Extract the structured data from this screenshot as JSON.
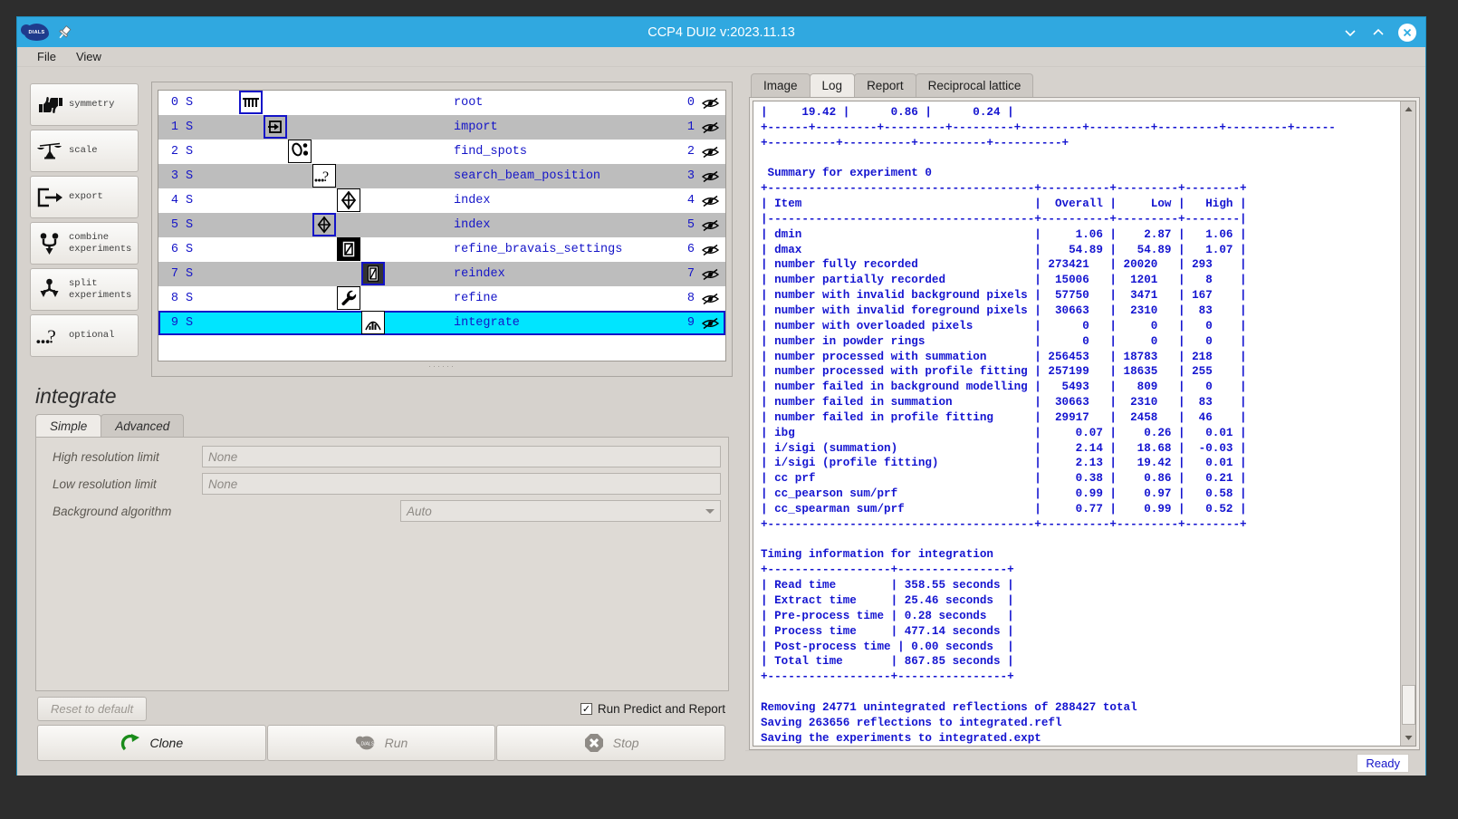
{
  "titlebar": {
    "title": "CCP4 DUI2 v:2023.11.13",
    "logo_text": "DIALS",
    "minimize_icon": "chevron-down-icon",
    "maximize_icon": "chevron-up-icon",
    "close_icon": "close-icon"
  },
  "menubar": {
    "items": [
      "File",
      "View"
    ]
  },
  "sidebar": {
    "items": [
      {
        "label": "symmetry",
        "icon": "thumbs-updown-icon"
      },
      {
        "label": "scale",
        "icon": "balance-scale-icon"
      },
      {
        "label": "export",
        "icon": "export-arrow-icon"
      },
      {
        "label": "combine\nexperiments",
        "icon": "combine-icon"
      },
      {
        "label": "split\nexperiments",
        "icon": "split-icon"
      },
      {
        "label": "optional",
        "icon": "question-dots-icon"
      }
    ]
  },
  "tree": {
    "rows": [
      {
        "index": "0",
        "flag": "S",
        "name": "root",
        "num": "0",
        "icon": "bars-icon",
        "selected": false
      },
      {
        "index": "1",
        "flag": "S",
        "name": "import",
        "num": "1",
        "icon": "import-icon",
        "selected": false
      },
      {
        "index": "2",
        "flag": "S",
        "name": "find_spots",
        "num": "2",
        "icon": "find-spots-icon",
        "selected": false
      },
      {
        "index": "3",
        "flag": "S",
        "name": "search_beam_position",
        "num": "3",
        "icon": "question-dots-icon",
        "selected": false
      },
      {
        "index": "4",
        "flag": "S",
        "name": "index",
        "num": "4",
        "icon": "index-diamond-icon",
        "selected": false
      },
      {
        "index": "5",
        "flag": "S",
        "name": "index",
        "num": "5",
        "icon": "index-diamond-icon",
        "selected": false
      },
      {
        "index": "6",
        "flag": "S",
        "name": "refine_bravais_settings",
        "num": "6",
        "icon": "bravais-icon",
        "selected": false
      },
      {
        "index": "7",
        "flag": "S",
        "name": "reindex",
        "num": "7",
        "icon": "reindex-icon",
        "selected": false
      },
      {
        "index": "8",
        "flag": "S",
        "name": "refine",
        "num": "8",
        "icon": "wrench-icon",
        "selected": false
      },
      {
        "index": "9",
        "flag": "S",
        "name": "integrate",
        "num": "9",
        "icon": "integrate-icon",
        "selected": true
      }
    ],
    "eye_icon": "eye-hidden-icon"
  },
  "task": {
    "title": "integrate",
    "tabs": [
      {
        "label": "Simple",
        "active": true
      },
      {
        "label": "Advanced",
        "active": false
      }
    ],
    "fields": [
      {
        "label": "High resolution limit",
        "value": "None",
        "type": "text"
      },
      {
        "label": "Low resolution limit",
        "value": "None",
        "type": "text"
      },
      {
        "label": "Background algorithm",
        "value": "Auto",
        "type": "select"
      }
    ],
    "reset_label": "Reset to default",
    "predict_label": "Run Predict and Report",
    "predict_checked": true,
    "check_glyph": "✓",
    "actions": [
      {
        "label": "Clone",
        "icon": "clone-arrow-icon",
        "enabled": true
      },
      {
        "label": "Run",
        "icon": "dials-run-icon",
        "enabled": false
      },
      {
        "label": "Stop",
        "icon": "stop-octagon-icon",
        "enabled": false
      }
    ]
  },
  "right_panel": {
    "tabs": [
      {
        "label": "Image",
        "active": false
      },
      {
        "label": "Log",
        "active": true
      },
      {
        "label": "Report",
        "active": false
      },
      {
        "label": "Reciprocal lattice",
        "active": false
      }
    ],
    "log_text": "|     19.42 |      0.86 |      0.24 |\n+------+---------+---------+---------+---------+---------+---------+---------+------\n+----------+----------+----------+----------+\n\n Summary for experiment 0\n+---------------------------------------+----------+---------+--------+\n| Item                                  |  Overall |     Low |   High |\n|---------------------------------------+----------+---------+--------|\n| dmin                                  |     1.06 |    2.87 |   1.06 |\n| dmax                                  |    54.89 |   54.89 |   1.07 |\n| number fully recorded                 | 273421   | 20020   | 293    |\n| number partially recorded             |  15006   |  1201   |   8    |\n| number with invalid background pixels |  57750   |  3471   | 167    |\n| number with invalid foreground pixels |  30663   |  2310   |  83    |\n| number with overloaded pixels         |      0   |     0   |   0    |\n| number in powder rings                |      0   |     0   |   0    |\n| number processed with summation       | 256453   | 18783   | 218    |\n| number processed with profile fitting | 257199   | 18635   | 255    |\n| number failed in background modelling |   5493   |   809   |   0    |\n| number failed in summation            |  30663   |  2310   |  83    |\n| number failed in profile fitting      |  29917   |  2458   |  46    |\n| ibg                                   |     0.07 |    0.26 |   0.01 |\n| i/sigi (summation)                    |     2.14 |   18.68 |  -0.03 |\n| i/sigi (profile fitting)              |     2.13 |   19.42 |   0.01 |\n| cc prf                                |     0.38 |    0.86 |   0.21 |\n| cc_pearson sum/prf                    |     0.99 |    0.97 |   0.58 |\n| cc_spearman sum/prf                   |     0.77 |    0.99 |   0.52 |\n+---------------------------------------+----------+---------+--------+\n\nTiming information for integration\n+------------------+----------------+\n| Read time        | 358.55 seconds |\n| Extract time     | 25.46 seconds  |\n| Pre-process time | 0.28 seconds   |\n| Process time     | 477.14 seconds |\n| Post-process time | 0.00 seconds  |\n| Total time       | 867.85 seconds |\n+------------------+----------------+\n\nRemoving 24771 unintegrated reflections of 288427 total\nSaving 263656 reflections to integrated.refl\nSaving the experiments to integrated.expt",
    "scroll_up_icon": "scroll-up-arrow-icon",
    "scroll_down_icon": "scroll-down-arrow-icon"
  },
  "statusbar": {
    "text": "Ready"
  }
}
